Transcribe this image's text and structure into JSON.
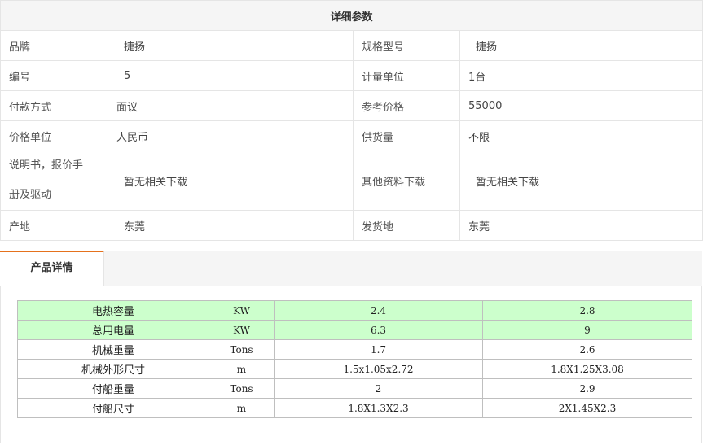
{
  "params": {
    "title": "详细参数",
    "rows": [
      {
        "k1": "品牌",
        "v1": "捷扬",
        "k2": "规格型号",
        "v2": "捷扬"
      },
      {
        "k1": "编号",
        "v1": "5",
        "k2": "计量单位",
        "v2": "1台"
      },
      {
        "k1": "付款方式",
        "v1": "面议",
        "k2": "参考价格",
        "v2": "55000"
      },
      {
        "k1": "价格单位",
        "v1": "人民币",
        "k2": "供货量",
        "v2": "不限"
      },
      {
        "k1_line1": "说明书，报价手",
        "k1_line2": "册及驱动",
        "v1": "暂无相关下载",
        "k2": "其他资料下载",
        "v2": "暂无相关下载"
      },
      {
        "k1": "产地",
        "v1": "东莞",
        "k2": "发货地",
        "v2": "东莞"
      }
    ]
  },
  "tabs": [
    {
      "label": "产品详情",
      "active": true
    }
  ],
  "spec_table": {
    "highlight_color": "#ccffcc",
    "rows": [
      {
        "name": "电热容量",
        "unit": "KW",
        "a": "2.4",
        "b": "2.8",
        "highlight": true
      },
      {
        "name": "总用电量",
        "unit": "KW",
        "a": "6.3",
        "b": "9",
        "highlight": true
      },
      {
        "name": "机械重量",
        "unit": "Tons",
        "a": "1.7",
        "b": "2.6",
        "highlight": false
      },
      {
        "name": "机械外形尺寸",
        "unit": "m",
        "a": "1.5x1.05x2.72",
        "b": "1.8X1.25X3.08",
        "highlight": false
      },
      {
        "name": "付船重量",
        "unit": "Tons",
        "a": "2",
        "b": "2.9",
        "highlight": false
      },
      {
        "name": "付船尺寸",
        "unit": "m",
        "a": "1.8X1.3X2.3",
        "b": "2X1.45X2.3",
        "highlight": false
      }
    ]
  },
  "colors": {
    "accent": "#e5711d",
    "header_bg": "#f5f5f5",
    "border": "#e5e5e5"
  }
}
